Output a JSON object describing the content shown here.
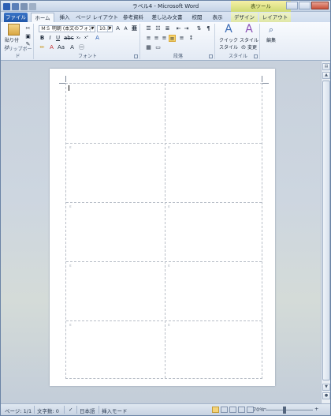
{
  "window": {
    "title": "ラベル4 - Microsoft Word",
    "context_tab_group": "表ツール"
  },
  "tabs": [
    {
      "label": "ファイル"
    },
    {
      "label": "ホーム"
    },
    {
      "label": "挿入"
    },
    {
      "label": "ページ レイアウト"
    },
    {
      "label": "参考資料"
    },
    {
      "label": "差し込み文書"
    },
    {
      "label": "校閲"
    },
    {
      "label": "表示"
    },
    {
      "label": "デザイン"
    },
    {
      "label": "レイアウト"
    }
  ],
  "ribbon": {
    "clipboard": {
      "paste_label": "貼り付け",
      "group_label": "クリップボード"
    },
    "font": {
      "font_name": "ＭＳ 明朝 (本文のフォン",
      "font_size": "10.5",
      "group_label": "フォント"
    },
    "paragraph": {
      "group_label": "段落"
    },
    "styles": {
      "quick_style": "クイック スタイル",
      "change_style": "スタイルの 変更",
      "group_label": "スタイル"
    },
    "editing": {
      "label": "編集"
    }
  },
  "statusbar": {
    "page": "ページ: 1/1",
    "word_count": "文字数: 0",
    "language": "日本語",
    "mode": "挿入モード",
    "zoom": "70%"
  },
  "colors": {
    "accent": "#1f56a8",
    "context_tab": "#dfe7a5"
  },
  "icons": [
    "paste-icon",
    "bold-icon",
    "italic-icon",
    "underline-icon",
    "styles-icon",
    "find-icon"
  ]
}
